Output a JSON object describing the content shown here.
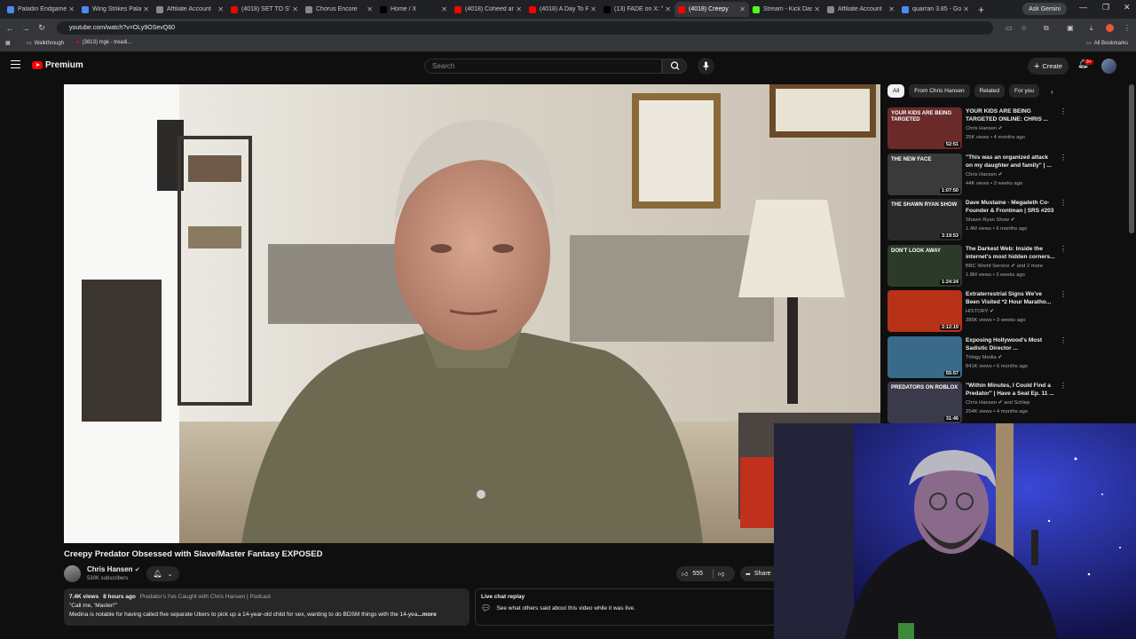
{
  "browser": {
    "tabs": [
      {
        "label": "Paladin Endgame",
        "color": "#4a8af4"
      },
      {
        "label": "Wing Strikes Palad",
        "color": "#4a8af4"
      },
      {
        "label": "Affiliate Account",
        "color": "#888888"
      },
      {
        "label": "(4018) SET TO STUN",
        "color": "#ff0000"
      },
      {
        "label": "Chorus Encore",
        "color": "#888888"
      },
      {
        "label": "Home / X",
        "color": "#000000"
      },
      {
        "label": "(4018) Coheed and",
        "color": "#ff0000"
      },
      {
        "label": "(4018) A Day To Re",
        "color": "#ff0000"
      },
      {
        "label": "(13) FADE on X: \"I\"",
        "color": "#000000"
      },
      {
        "label": "(4018) Creepy",
        "color": "#ff0000",
        "active": true
      },
      {
        "label": "Stream - Kick Dash",
        "color": "#53fc18"
      },
      {
        "label": "Affiliate Account",
        "color": "#888888"
      },
      {
        "label": "quarran 3.85 - Goo",
        "color": "#4a8af4"
      }
    ],
    "ask_gemini": "Ask Gemini",
    "url": "youtube.com/watch?v=OLy9OSevQ60",
    "bookmarks": {
      "all_bookmarks": "All Bookmarks",
      "items": [
        "Walkthrough",
        "(3813) mgk - treadi..."
      ]
    }
  },
  "header": {
    "brand": "Premium",
    "search_placeholder": "Search",
    "create_label": "Create",
    "notif_badge": "9+"
  },
  "video": {
    "title": "Creepy Predator Obsessed with Slave/Master Fantasy EXPOSED"
  },
  "channel": {
    "name": "Chris Hansen",
    "subscribers": "530K subscribers"
  },
  "actions": {
    "likes": "555",
    "share": "Share"
  },
  "description": {
    "views": "7.4K views",
    "age": "8 hours ago",
    "playlist": "Predator's I've Caught with Chris Hansen | Podcast",
    "line1": "\"Call me, 'Master!'\"",
    "line2": "Medina is notable for having called five separate Ubers to pick up a 14-year-old child for sex, wanting to do BDSM things with the 14-yea",
    "more": "...more"
  },
  "live_chat": {
    "title": "Live chat replay",
    "subtitle": "See what others said about this video while it was live."
  },
  "chips": [
    "All",
    "From Chris Hansen",
    "Related",
    "For you"
  ],
  "recommendations": [
    {
      "title": "YOUR KIDS ARE BEING TARGETED ONLINE: CHRIS ...",
      "channel": "Chris Hansen",
      "meta": "25K views • 4 months ago",
      "duration": "52:51",
      "thumb_bg": "#6b2a2a",
      "thumb_text": "YOUR KIDS ARE BEING TARGETED"
    },
    {
      "title": "\"This was an organized attack on my daughter and family\" | ...",
      "channel": "Chris Hansen",
      "meta": "44K views • 3 weeks ago",
      "duration": "1:07:50",
      "thumb_bg": "#3a3a3a",
      "thumb_text": "THE NEW FACE"
    },
    {
      "title": "Dave Mustaine - Megadeth Co-Founder & Frontman | SRS #203",
      "channel": "Shawn Ryan Show",
      "meta": "1.4M views • 9 months ago",
      "duration": "3:19:53",
      "thumb_bg": "#2a2a2a",
      "thumb_text": "THE SHAWN RYAN SHOW"
    },
    {
      "title": "The Darkest Web: Inside the internet's most hidden corners...",
      "channel": "BBC World Service",
      "channel_extra": "and 2 more",
      "meta": "1.8M views • 3 weeks ago",
      "duration": "1:24:24",
      "thumb_bg": "#2c3a2a",
      "thumb_text": "Don't Look Away"
    },
    {
      "title": "Extraterrestrial Signs We've Been Visited *2 Hour Maratho...",
      "channel": "HISTORY",
      "meta": "385K views • 3 weeks ago",
      "duration": "2:12:19",
      "thumb_bg": "#b83218",
      "thumb_text": ""
    },
    {
      "title": "Exposing Hollywood's Most Sadistic Director ...",
      "channel": "Trilogy Media",
      "meta": "841K views • 6 months ago",
      "duration": "55:57",
      "thumb_bg": "#3a6a8a",
      "thumb_text": ""
    },
    {
      "title": "\"Within Minutes, I Could Find a Predator\" | Have a Seat Ep. 11 ...",
      "channel": "Chris Hansen",
      "channel_extra": "and Schlep",
      "meta": "254K views • 4 months ago",
      "duration": "31:46",
      "thumb_bg": "#3a3a4a",
      "thumb_text": "PREDATORS ON ROBLOX"
    }
  ]
}
